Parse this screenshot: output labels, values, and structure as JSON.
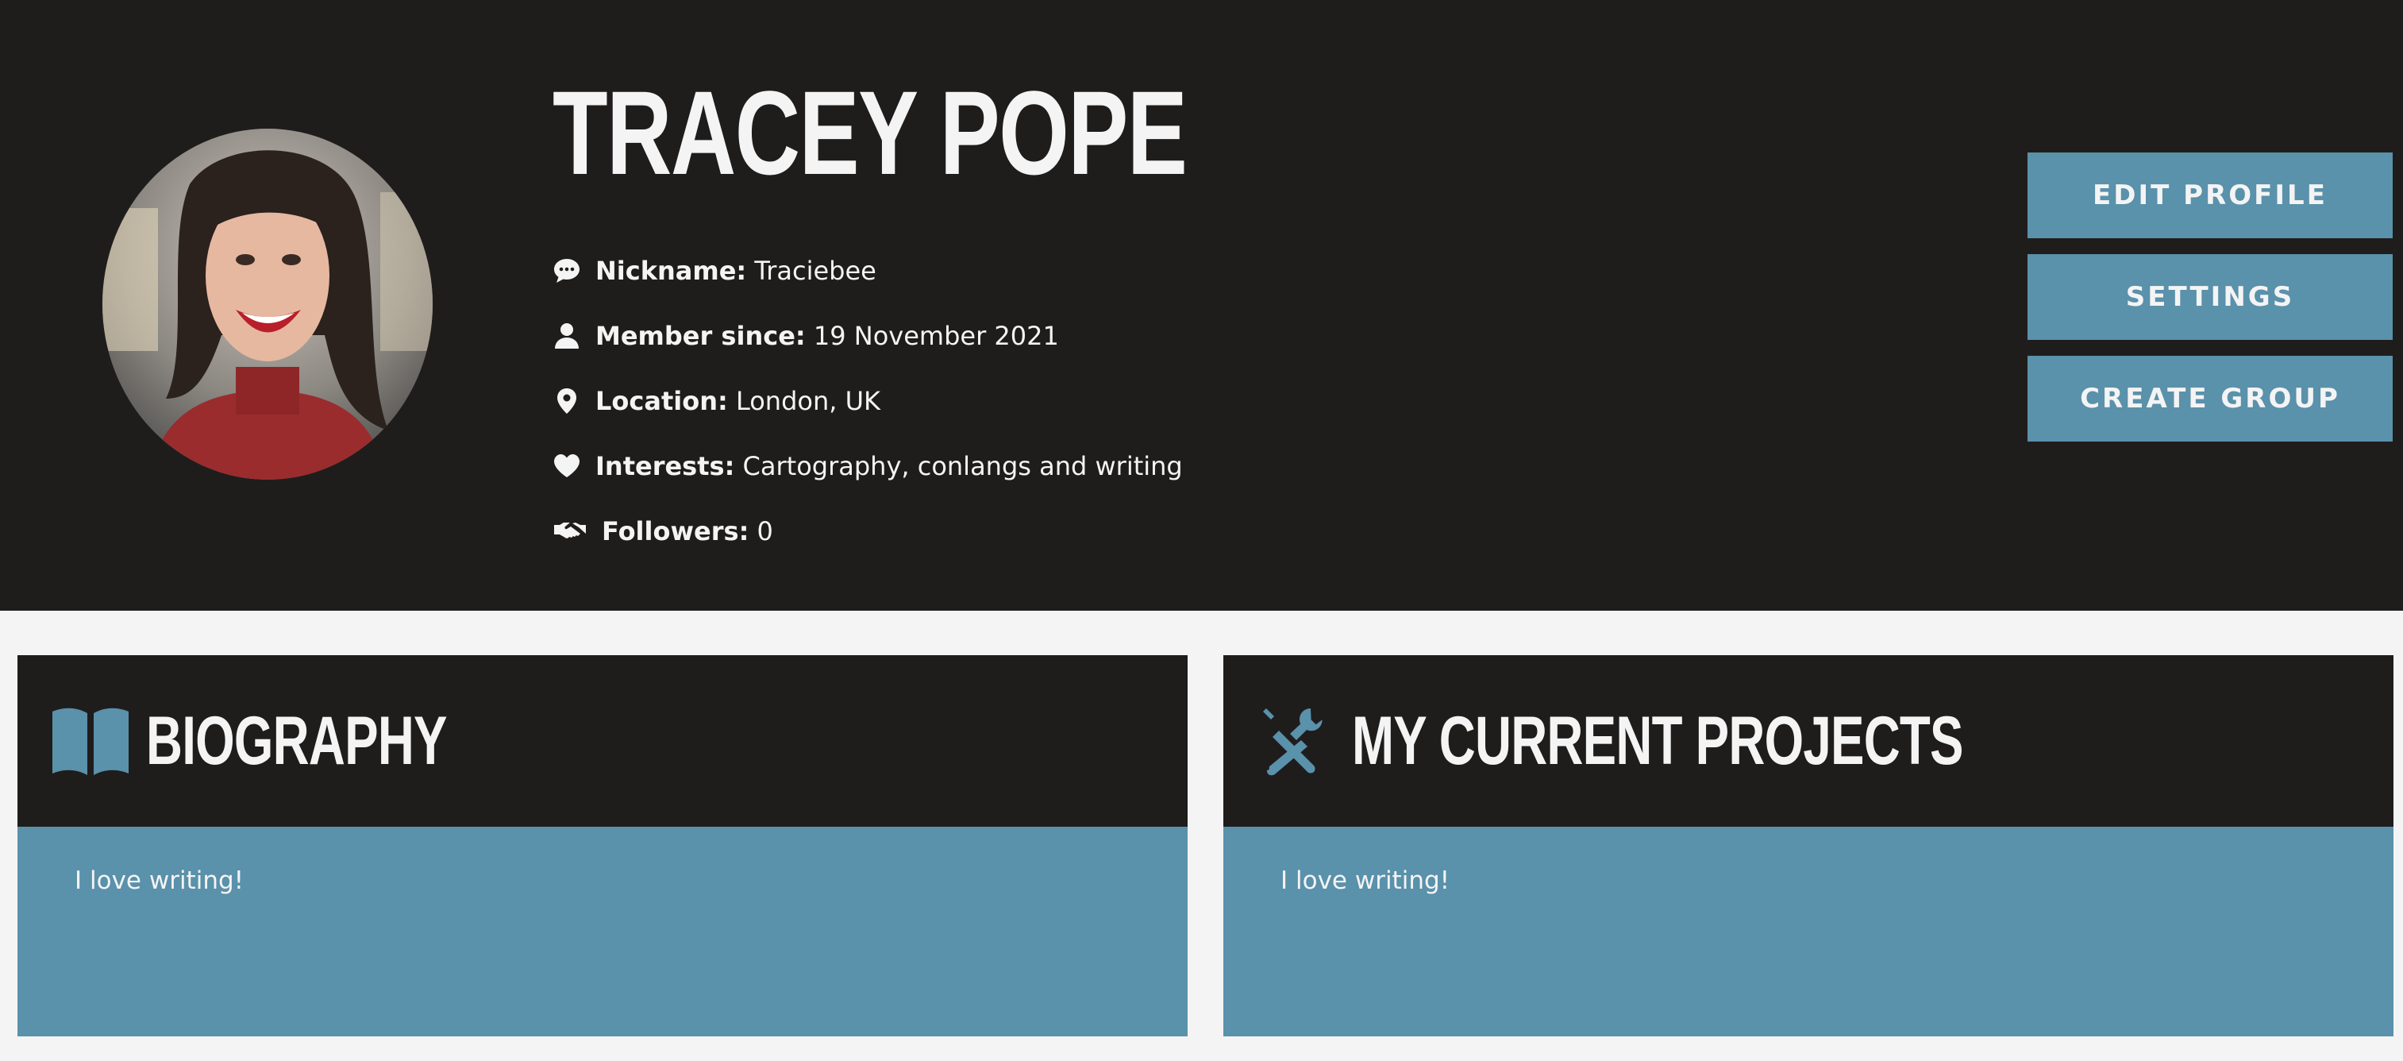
{
  "profile": {
    "name": "TRACEY POPE",
    "info": [
      {
        "icon": "speech-bubble-icon",
        "label": "Nickname:",
        "value": "Traciebee"
      },
      {
        "icon": "user-icon",
        "label": "Member since:",
        "value": "19 November 2021"
      },
      {
        "icon": "map-pin-icon",
        "label": "Location:",
        "value": "London, UK"
      },
      {
        "icon": "heart-icon",
        "label": "Interests:",
        "value": "Cartography, conlangs and writing"
      },
      {
        "icon": "handshake-icon",
        "label": "Followers:",
        "value": "0"
      }
    ]
  },
  "actions": {
    "edit_profile": "EDIT PROFILE",
    "settings": "SETTINGS",
    "create_group": "CREATE GROUP"
  },
  "panels": {
    "biography": {
      "icon": "open-book-icon",
      "title": "BIOGRAPHY",
      "text": "I love writing!"
    },
    "projects": {
      "icon": "tools-icon",
      "title": "MY CURRENT PROJECTS",
      "text": "I love writing!"
    }
  },
  "colors": {
    "header_bg": "#1f1d1c",
    "accent": "#5a91ab",
    "page_bg": "#f4f4f4",
    "text_light": "#f4f4f4"
  }
}
